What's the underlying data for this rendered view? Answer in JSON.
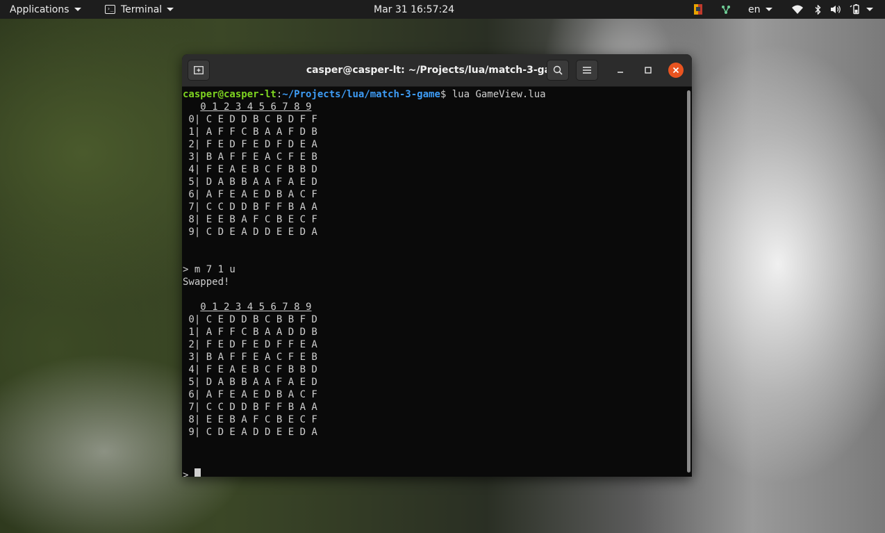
{
  "topbar": {
    "applications": "Applications",
    "terminal": "Terminal",
    "clock": "Mar 31  16:57:24",
    "lang": "en"
  },
  "tray": {
    "icons": [
      "app-indicator-icon",
      "network-share-icon",
      "wifi-icon",
      "bluetooth-icon",
      "volume-icon",
      "battery-icon"
    ]
  },
  "window": {
    "title": "casper@casper-lt: ~/Projects/lua/match-3-game"
  },
  "terminal": {
    "prompt_user": "casper@casper-lt",
    "prompt_colon": ":",
    "prompt_path": "~/Projects/lua/match-3-game",
    "prompt_dollar": "$ ",
    "command": "lua GameView.lua",
    "header_indent": "   ",
    "header_text": "0 1 2 3 4 5 6 7 8 9",
    "board1": [
      " 0| C E D D B C B D F F",
      " 1| A F F C B A A F D B",
      " 2| F E D F E D F D E A",
      " 3| B A F F E A C F E B",
      " 4| F E A E B C F B B D",
      " 5| D A B B A A F A E D",
      " 6| A F E A E D B A C F",
      " 7| C C D D B F F B A A",
      " 8| E E B A F C B E C F",
      " 9| C D E A D D E E D A"
    ],
    "input_line": "> m 7 1 u",
    "message": "Swapped!",
    "board2": [
      " 0| C E D D B C B B F D",
      " 1| A F F C B A A D D B",
      " 2| F E D F E D F F E A",
      " 3| B A F F E A C F E B",
      " 4| F E A E B C F B B D",
      " 5| D A B B A A F A E D",
      " 6| A F E A E D B A C F",
      " 7| C C D D B F F B A A",
      " 8| E E B A F C B E C F",
      " 9| C D E A D D E E D A"
    ],
    "final_prompt": "> "
  }
}
